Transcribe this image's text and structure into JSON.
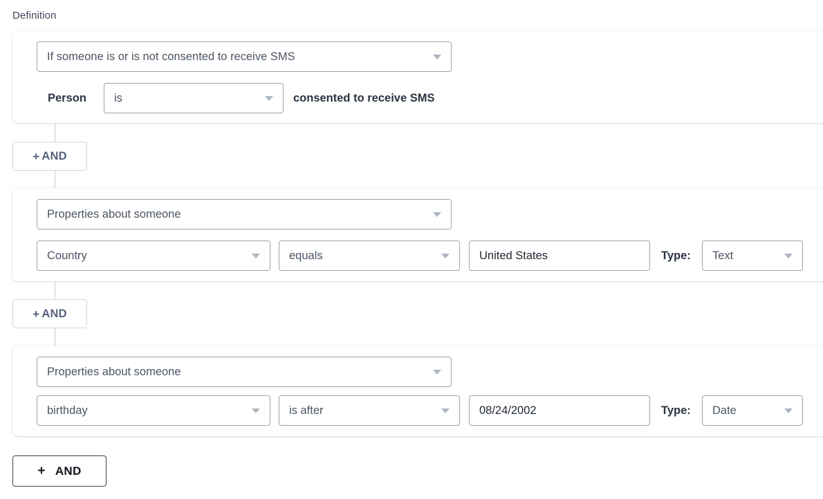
{
  "section": {
    "label": "Definition"
  },
  "colors": {
    "card_bg": "#ffffff",
    "page_bg": "#ffffff",
    "field_border": "#9aa3b0",
    "and_small_text": "#56627a",
    "and_large_text": "#11161d",
    "caret": "#aeb6c2",
    "connector_line": "#c6ccd6"
  },
  "blocks": [
    {
      "trigger": {
        "value": "If someone is or is not consented to receive SMS",
        "icon": "chevron-down-icon"
      },
      "row": {
        "prefix_label": "Person",
        "operator": {
          "value": "is",
          "icon": "chevron-down-icon"
        },
        "suffix_label": "consented to receive SMS"
      }
    },
    {
      "trigger": {
        "value": "Properties about someone",
        "icon": "chevron-down-icon"
      },
      "row": {
        "property": {
          "value": "Country",
          "icon": "chevron-down-icon"
        },
        "operator": {
          "value": "equals",
          "icon": "chevron-down-icon"
        },
        "input": {
          "value": "United States",
          "placeholder": "Value"
        },
        "type_label": "Type:",
        "type": {
          "value": "Text",
          "icon": "chevron-down-icon"
        }
      }
    },
    {
      "trigger": {
        "value": "Properties about someone",
        "icon": "chevron-down-icon"
      },
      "row": {
        "property": {
          "value": "birthday",
          "icon": "chevron-down-icon"
        },
        "operator": {
          "value": "is after",
          "icon": "chevron-down-icon"
        },
        "input": {
          "value": "08/24/2002",
          "placeholder": "Value"
        },
        "type_label": "Type:",
        "type": {
          "value": "Date",
          "icon": "chevron-down-icon"
        }
      }
    }
  ],
  "and_buttons": {
    "plus": "+",
    "label": "AND"
  }
}
